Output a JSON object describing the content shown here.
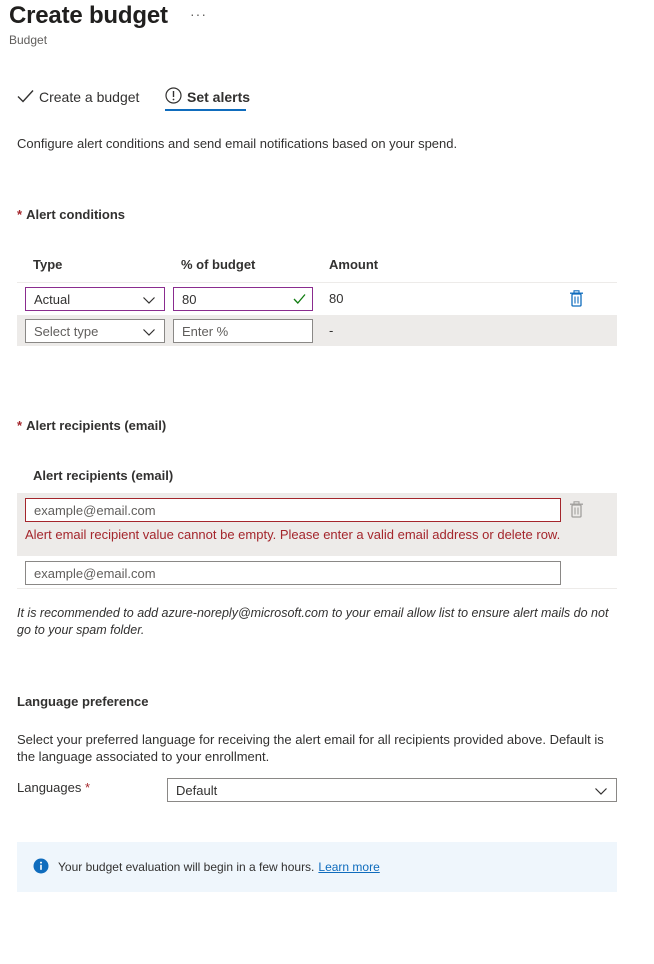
{
  "header": {
    "title": "Create budget",
    "more_label": "···",
    "subtitle": "Budget"
  },
  "tabs": [
    {
      "label": "Create a budget",
      "icon": "checkmark-icon",
      "selected": false
    },
    {
      "label": "Set alerts",
      "icon": "alert-circle-icon",
      "selected": true
    }
  ],
  "description": "Configure alert conditions and send email notifications based on your spend.",
  "alert_conditions": {
    "required_mark": "*",
    "title": "Alert conditions",
    "columns": [
      "Type",
      "% of budget",
      "Amount"
    ],
    "rows": [
      {
        "type": "Actual",
        "percent": "80",
        "amount": "80",
        "valid": true
      },
      {
        "type_placeholder": "Select type",
        "percent_placeholder": "Enter %",
        "amount": "-"
      }
    ]
  },
  "alert_recipients": {
    "required_mark": "*",
    "title": "Alert recipients (email)",
    "column_header": "Alert recipients (email)",
    "email_placeholder": "example@email.com",
    "error_message": "Alert email recipient value cannot be empty. Please enter a valid email address or delete row.",
    "note": "It is recommended to add azure-noreply@microsoft.com to your email allow list to ensure alert mails do not go to your spam folder."
  },
  "language": {
    "title": "Language preference",
    "description": "Select your preferred language for receiving the alert email for all recipients provided above. Default is the language associated to your enrollment.",
    "label": "Languages",
    "required_mark": "*",
    "value": "Default"
  },
  "info": {
    "text": "Your budget evaluation will begin in a few hours.",
    "link": "Learn more"
  },
  "colors": {
    "accent": "#0f6cbd",
    "error": "#a4262c",
    "focus_border": "#8a2c8f",
    "valid_check": "#107c10"
  }
}
